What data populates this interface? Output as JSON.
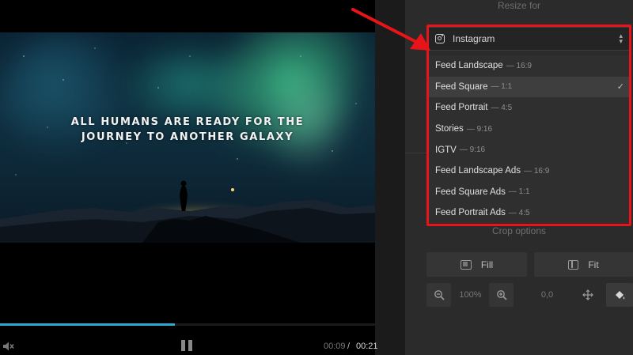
{
  "player": {
    "overlay_text": "ALL HUMANS ARE READY FOR THE JOURNEY TO ANOTHER GALAXY",
    "progress": 0.466,
    "current_time": "00:09",
    "separator": "/",
    "total_time": "00:21"
  },
  "panel": {
    "resize_label": "Resize for",
    "platform": {
      "icon": "instagram-icon",
      "value": "Instagram"
    },
    "dropdown": {
      "items": [
        {
          "label": "Feed Landscape",
          "ratio": "— 16:9",
          "selected": false
        },
        {
          "label": "Feed Square",
          "ratio": "— 1:1",
          "selected": true
        },
        {
          "label": "Feed Portrait",
          "ratio": "— 4:5",
          "selected": false
        },
        {
          "label": "Stories",
          "ratio": "— 9:16",
          "selected": false
        },
        {
          "label": "IGTV",
          "ratio": "— 9:16",
          "selected": false
        },
        {
          "label": "Feed Landscape Ads",
          "ratio": "— 16:9",
          "selected": false
        },
        {
          "label": "Feed Square Ads",
          "ratio": "— 1:1",
          "selected": false
        },
        {
          "label": "Feed Portrait Ads",
          "ratio": "— 4:5",
          "selected": false
        }
      ]
    },
    "crop_label": "Crop options",
    "fill_label": "Fill",
    "fit_label": "Fit",
    "zoom_value": "100%",
    "position_value": "0,0"
  },
  "colors": {
    "highlight": "#e8141a",
    "progress": "#2fa8d6"
  }
}
